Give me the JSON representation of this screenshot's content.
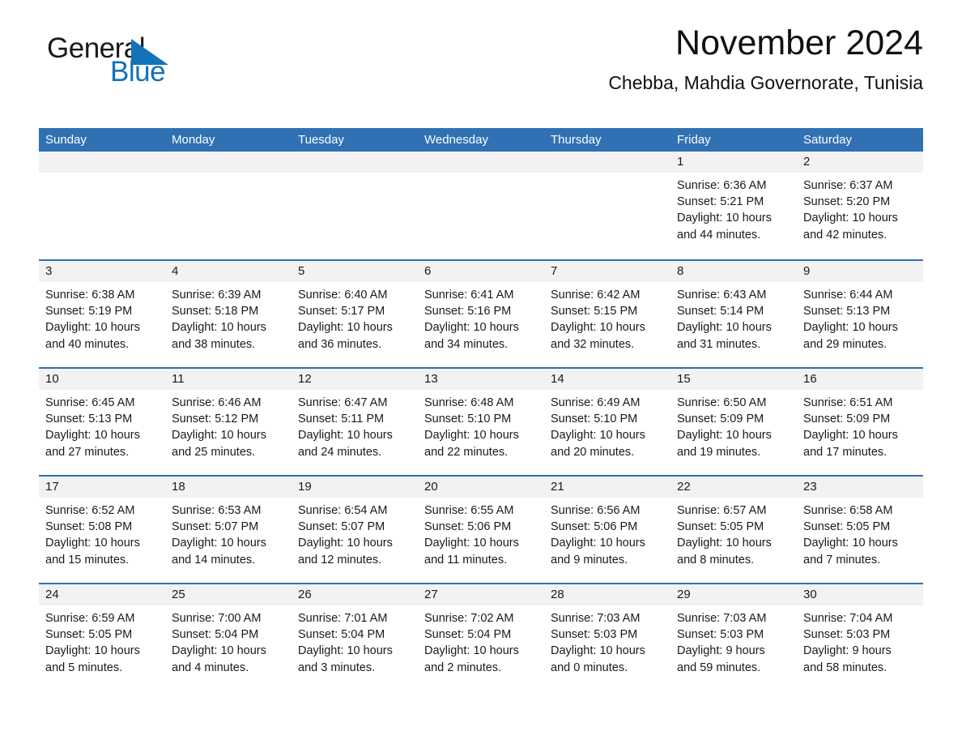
{
  "brand": {
    "word_one": "General",
    "word_two": "Blue",
    "triangle_color": "#1372b8",
    "text_color": "#1a1a1a"
  },
  "header": {
    "title": "November 2024",
    "subtitle": "Chebba, Mahdia Governorate, Tunisia"
  },
  "colors": {
    "header_blue": "#3071b3",
    "row_rule_blue": "#3071b3",
    "daynum_band": "#f2f2f2",
    "page_background": "#ffffff",
    "text": "#1a1a1a"
  },
  "weekday_headers": [
    "Sunday",
    "Monday",
    "Tuesday",
    "Wednesday",
    "Thursday",
    "Friday",
    "Saturday"
  ],
  "weeks": [
    [
      {
        "day": "",
        "sunrise": "",
        "sunset": "",
        "daylight_1": "",
        "daylight_2": ""
      },
      {
        "day": "",
        "sunrise": "",
        "sunset": "",
        "daylight_1": "",
        "daylight_2": ""
      },
      {
        "day": "",
        "sunrise": "",
        "sunset": "",
        "daylight_1": "",
        "daylight_2": ""
      },
      {
        "day": "",
        "sunrise": "",
        "sunset": "",
        "daylight_1": "",
        "daylight_2": ""
      },
      {
        "day": "",
        "sunrise": "",
        "sunset": "",
        "daylight_1": "",
        "daylight_2": ""
      },
      {
        "day": "1",
        "sunrise": "Sunrise: 6:36 AM",
        "sunset": "Sunset: 5:21 PM",
        "daylight_1": "Daylight: 10 hours",
        "daylight_2": "and 44 minutes."
      },
      {
        "day": "2",
        "sunrise": "Sunrise: 6:37 AM",
        "sunset": "Sunset: 5:20 PM",
        "daylight_1": "Daylight: 10 hours",
        "daylight_2": "and 42 minutes."
      }
    ],
    [
      {
        "day": "3",
        "sunrise": "Sunrise: 6:38 AM",
        "sunset": "Sunset: 5:19 PM",
        "daylight_1": "Daylight: 10 hours",
        "daylight_2": "and 40 minutes."
      },
      {
        "day": "4",
        "sunrise": "Sunrise: 6:39 AM",
        "sunset": "Sunset: 5:18 PM",
        "daylight_1": "Daylight: 10 hours",
        "daylight_2": "and 38 minutes."
      },
      {
        "day": "5",
        "sunrise": "Sunrise: 6:40 AM",
        "sunset": "Sunset: 5:17 PM",
        "daylight_1": "Daylight: 10 hours",
        "daylight_2": "and 36 minutes."
      },
      {
        "day": "6",
        "sunrise": "Sunrise: 6:41 AM",
        "sunset": "Sunset: 5:16 PM",
        "daylight_1": "Daylight: 10 hours",
        "daylight_2": "and 34 minutes."
      },
      {
        "day": "7",
        "sunrise": "Sunrise: 6:42 AM",
        "sunset": "Sunset: 5:15 PM",
        "daylight_1": "Daylight: 10 hours",
        "daylight_2": "and 32 minutes."
      },
      {
        "day": "8",
        "sunrise": "Sunrise: 6:43 AM",
        "sunset": "Sunset: 5:14 PM",
        "daylight_1": "Daylight: 10 hours",
        "daylight_2": "and 31 minutes."
      },
      {
        "day": "9",
        "sunrise": "Sunrise: 6:44 AM",
        "sunset": "Sunset: 5:13 PM",
        "daylight_1": "Daylight: 10 hours",
        "daylight_2": "and 29 minutes."
      }
    ],
    [
      {
        "day": "10",
        "sunrise": "Sunrise: 6:45 AM",
        "sunset": "Sunset: 5:13 PM",
        "daylight_1": "Daylight: 10 hours",
        "daylight_2": "and 27 minutes."
      },
      {
        "day": "11",
        "sunrise": "Sunrise: 6:46 AM",
        "sunset": "Sunset: 5:12 PM",
        "daylight_1": "Daylight: 10 hours",
        "daylight_2": "and 25 minutes."
      },
      {
        "day": "12",
        "sunrise": "Sunrise: 6:47 AM",
        "sunset": "Sunset: 5:11 PM",
        "daylight_1": "Daylight: 10 hours",
        "daylight_2": "and 24 minutes."
      },
      {
        "day": "13",
        "sunrise": "Sunrise: 6:48 AM",
        "sunset": "Sunset: 5:10 PM",
        "daylight_1": "Daylight: 10 hours",
        "daylight_2": "and 22 minutes."
      },
      {
        "day": "14",
        "sunrise": "Sunrise: 6:49 AM",
        "sunset": "Sunset: 5:10 PM",
        "daylight_1": "Daylight: 10 hours",
        "daylight_2": "and 20 minutes."
      },
      {
        "day": "15",
        "sunrise": "Sunrise: 6:50 AM",
        "sunset": "Sunset: 5:09 PM",
        "daylight_1": "Daylight: 10 hours",
        "daylight_2": "and 19 minutes."
      },
      {
        "day": "16",
        "sunrise": "Sunrise: 6:51 AM",
        "sunset": "Sunset: 5:09 PM",
        "daylight_1": "Daylight: 10 hours",
        "daylight_2": "and 17 minutes."
      }
    ],
    [
      {
        "day": "17",
        "sunrise": "Sunrise: 6:52 AM",
        "sunset": "Sunset: 5:08 PM",
        "daylight_1": "Daylight: 10 hours",
        "daylight_2": "and 15 minutes."
      },
      {
        "day": "18",
        "sunrise": "Sunrise: 6:53 AM",
        "sunset": "Sunset: 5:07 PM",
        "daylight_1": "Daylight: 10 hours",
        "daylight_2": "and 14 minutes."
      },
      {
        "day": "19",
        "sunrise": "Sunrise: 6:54 AM",
        "sunset": "Sunset: 5:07 PM",
        "daylight_1": "Daylight: 10 hours",
        "daylight_2": "and 12 minutes."
      },
      {
        "day": "20",
        "sunrise": "Sunrise: 6:55 AM",
        "sunset": "Sunset: 5:06 PM",
        "daylight_1": "Daylight: 10 hours",
        "daylight_2": "and 11 minutes."
      },
      {
        "day": "21",
        "sunrise": "Sunrise: 6:56 AM",
        "sunset": "Sunset: 5:06 PM",
        "daylight_1": "Daylight: 10 hours",
        "daylight_2": "and 9 minutes."
      },
      {
        "day": "22",
        "sunrise": "Sunrise: 6:57 AM",
        "sunset": "Sunset: 5:05 PM",
        "daylight_1": "Daylight: 10 hours",
        "daylight_2": "and 8 minutes."
      },
      {
        "day": "23",
        "sunrise": "Sunrise: 6:58 AM",
        "sunset": "Sunset: 5:05 PM",
        "daylight_1": "Daylight: 10 hours",
        "daylight_2": "and 7 minutes."
      }
    ],
    [
      {
        "day": "24",
        "sunrise": "Sunrise: 6:59 AM",
        "sunset": "Sunset: 5:05 PM",
        "daylight_1": "Daylight: 10 hours",
        "daylight_2": "and 5 minutes."
      },
      {
        "day": "25",
        "sunrise": "Sunrise: 7:00 AM",
        "sunset": "Sunset: 5:04 PM",
        "daylight_1": "Daylight: 10 hours",
        "daylight_2": "and 4 minutes."
      },
      {
        "day": "26",
        "sunrise": "Sunrise: 7:01 AM",
        "sunset": "Sunset: 5:04 PM",
        "daylight_1": "Daylight: 10 hours",
        "daylight_2": "and 3 minutes."
      },
      {
        "day": "27",
        "sunrise": "Sunrise: 7:02 AM",
        "sunset": "Sunset: 5:04 PM",
        "daylight_1": "Daylight: 10 hours",
        "daylight_2": "and 2 minutes."
      },
      {
        "day": "28",
        "sunrise": "Sunrise: 7:03 AM",
        "sunset": "Sunset: 5:03 PM",
        "daylight_1": "Daylight: 10 hours",
        "daylight_2": "and 0 minutes."
      },
      {
        "day": "29",
        "sunrise": "Sunrise: 7:03 AM",
        "sunset": "Sunset: 5:03 PM",
        "daylight_1": "Daylight: 9 hours",
        "daylight_2": "and 59 minutes."
      },
      {
        "day": "30",
        "sunrise": "Sunrise: 7:04 AM",
        "sunset": "Sunset: 5:03 PM",
        "daylight_1": "Daylight: 9 hours",
        "daylight_2": "and 58 minutes."
      }
    ]
  ]
}
